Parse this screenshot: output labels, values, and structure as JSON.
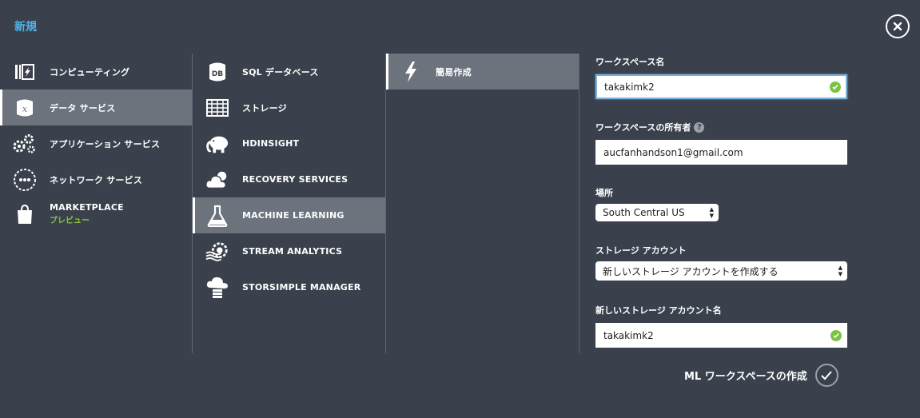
{
  "header": {
    "title": "新規"
  },
  "categories": [
    {
      "label": "コンピューティング",
      "icon": "compute-icon"
    },
    {
      "label": "データ サービス",
      "icon": "data-services-icon",
      "active": true
    },
    {
      "label": "アプリケーション サービス",
      "icon": "gears-icon"
    },
    {
      "label": "ネットワーク サービス",
      "icon": "network-icon"
    },
    {
      "label": "MARKETPLACE",
      "sublabel": "プレビュー",
      "icon": "shopping-bag-icon"
    }
  ],
  "services": [
    {
      "label": "SQL データベース",
      "icon": "database-icon"
    },
    {
      "label": "ストレージ",
      "icon": "storage-grid-icon"
    },
    {
      "label": "HDINSIGHT",
      "icon": "elephant-icon"
    },
    {
      "label": "RECOVERY SERVICES",
      "icon": "cloud-icon"
    },
    {
      "label": "MACHINE LEARNING",
      "icon": "flask-icon",
      "active": true
    },
    {
      "label": "STREAM ANALYTICS",
      "icon": "stream-gear-icon"
    },
    {
      "label": "STORSIMPLE MANAGER",
      "icon": "cloud-server-icon"
    }
  ],
  "options": [
    {
      "label": "簡易作成",
      "icon": "lightning-icon",
      "active": true
    }
  ],
  "form": {
    "workspace_name_label": "ワークスペース名",
    "workspace_name_value": "takakimk2",
    "owner_label": "ワークスペースの所有者",
    "owner_help": "?",
    "owner_value": "aucfanhandson1@gmail.com",
    "location_label": "場所",
    "location_value": "South Central US",
    "storage_account_label": "ストレージ アカウント",
    "storage_account_value": "新しいストレージ アカウントを作成する",
    "new_storage_name_label": "新しいストレージ アカウント名",
    "new_storage_name_value": "takakimk2"
  },
  "submit": {
    "label": "ML ワークスペースの作成"
  },
  "colors": {
    "background": "#3a414c",
    "active": "#6c737d",
    "title": "#4fb6e8",
    "valid": "#7cc242",
    "preview": "#8ac43f"
  }
}
